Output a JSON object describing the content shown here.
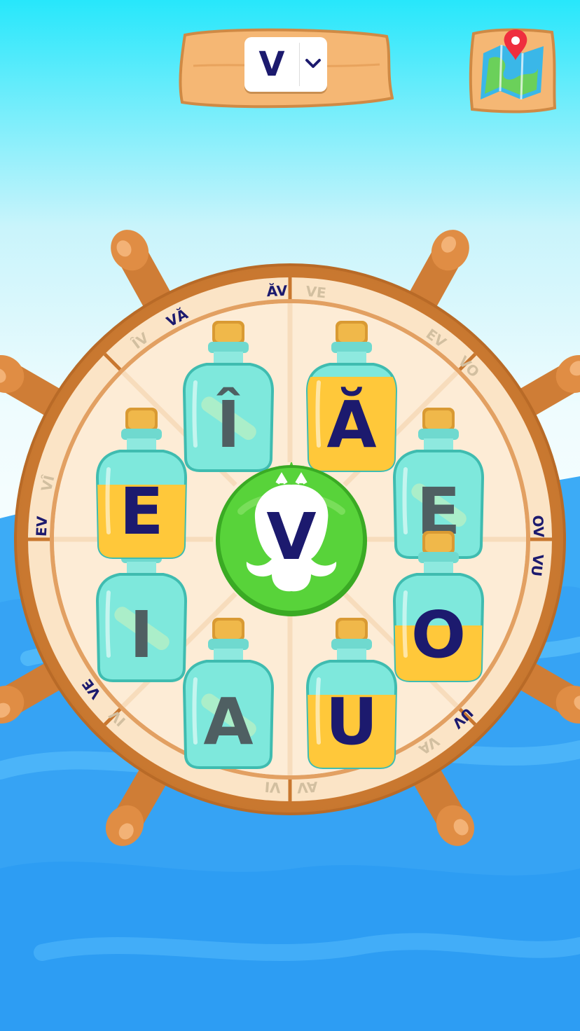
{
  "selector": {
    "value": "V"
  },
  "centre_letter": "V",
  "ring_labels": [
    {
      "text": "ĂV",
      "angle": -3,
      "color": "#1c1a6e"
    },
    {
      "text": "VE",
      "angle": 6,
      "color": "#d2bfa0"
    },
    {
      "text": "EV",
      "angle": 36,
      "color": "#d2bfa0"
    },
    {
      "text": "VO",
      "angle": 46,
      "color": "#d2bfa0"
    },
    {
      "text": "OV",
      "angle": 87,
      "color": "#1c1a6e"
    },
    {
      "text": "VU",
      "angle": 96,
      "color": "#1c1a6e"
    },
    {
      "text": "UV",
      "angle": 136,
      "color": "#1c1a6e"
    },
    {
      "text": "VA",
      "angle": 146,
      "color": "#d2bfa0"
    },
    {
      "text": "AV",
      "angle": 176,
      "color": "#d2bfa0"
    },
    {
      "text": "VI",
      "angle": 184,
      "color": "#d2bfa0"
    },
    {
      "text": "IV",
      "angle": 224,
      "color": "#d2bfa0"
    },
    {
      "text": "VE",
      "angle": 233,
      "color": "#1c1a6e"
    },
    {
      "text": "EV",
      "angle": 273,
      "color": "#1c1a6e"
    },
    {
      "text": "VÎ",
      "angle": 283,
      "color": "#d2bfa0"
    },
    {
      "text": "ÎV",
      "angle": 323,
      "color": "#d2bfa0"
    },
    {
      "text": "VĂ",
      "angle": 333,
      "color": "#1c1a6e"
    }
  ],
  "bottles": [
    {
      "letter": "Ă",
      "filled": true
    },
    {
      "letter": "E",
      "filled": false
    },
    {
      "letter": "O",
      "filled": true
    },
    {
      "letter": "U",
      "filled": true
    },
    {
      "letter": "A",
      "filled": false
    },
    {
      "letter": "I",
      "filled": false
    },
    {
      "letter": "E",
      "filled": true
    },
    {
      "letter": "Î",
      "filled": false
    }
  ],
  "colors": {
    "navy": "#1c1a6e",
    "grey_letter": "#4f5f62",
    "liquid": "#ffc83a",
    "glass": "#7ee8dc",
    "wood": "#d9843c",
    "green": "#4ec92f"
  }
}
